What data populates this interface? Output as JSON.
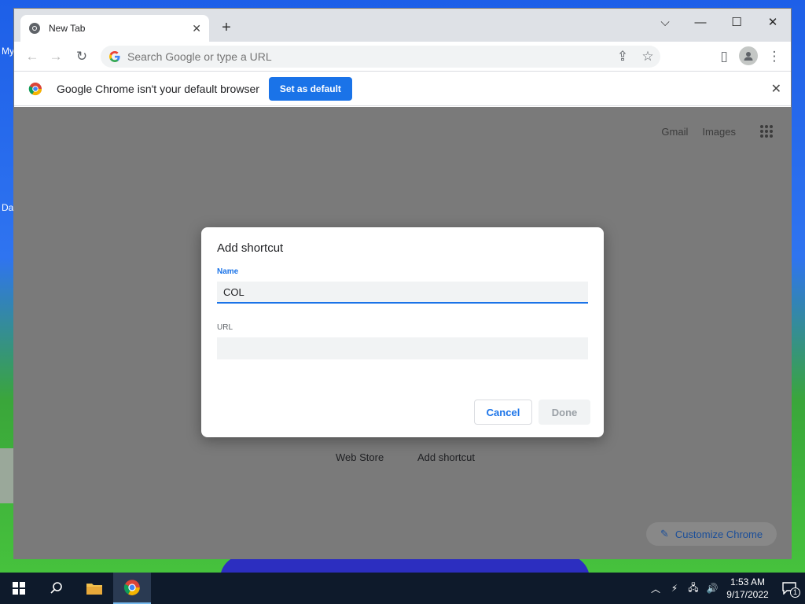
{
  "desktop": {
    "icon_labels": [
      "My",
      "Da"
    ]
  },
  "browser": {
    "tab": {
      "title": "New Tab"
    },
    "omnibox": {
      "placeholder": "Search Google or type a URL",
      "value": ""
    },
    "infobar": {
      "message": "Google Chrome isn't your default browser",
      "button_label": "Set as default"
    },
    "ntp": {
      "top_links": [
        "Gmail",
        "Images"
      ],
      "shortcuts": [
        "Web Store",
        "Add shortcut"
      ],
      "customize_label": "Customize Chrome"
    }
  },
  "dialog": {
    "title": "Add shortcut",
    "name_label": "Name",
    "name_value": "COL",
    "url_label": "URL",
    "url_value": "",
    "cancel_label": "Cancel",
    "done_label": "Done"
  },
  "taskbar": {
    "time": "1:53 AM",
    "date": "9/17/2022",
    "notification_count": "1"
  },
  "colors": {
    "accent": "#1a73e8",
    "taskbar": "#0e1a2b"
  }
}
